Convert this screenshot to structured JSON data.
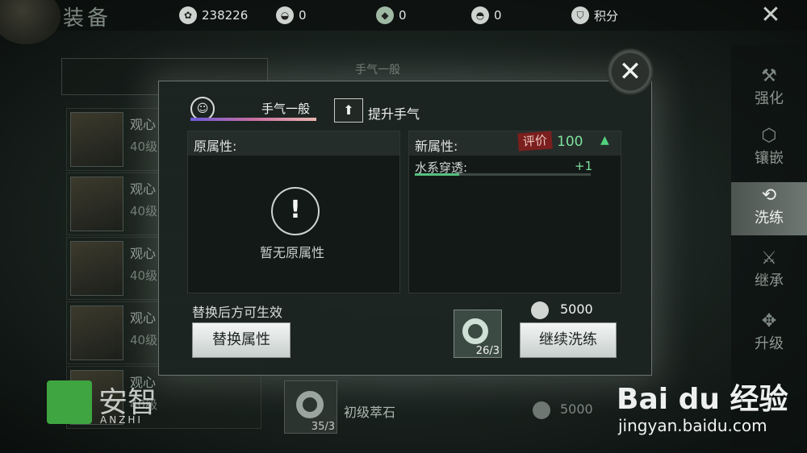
{
  "header": {
    "title": "装备",
    "currencies": [
      {
        "icon": "coin-icon",
        "value": "238226"
      },
      {
        "icon": "bowl-icon",
        "value": "0"
      },
      {
        "icon": "jade-icon",
        "value": "0"
      },
      {
        "icon": "pouch-icon",
        "value": "0"
      },
      {
        "icon": "shield-points-icon",
        "value": "积分"
      }
    ],
    "close_symbol": "✕"
  },
  "left_list": {
    "items": [
      {
        "name": "观心",
        "level": "40级"
      },
      {
        "name": "观心",
        "level": "40级"
      },
      {
        "name": "观心",
        "level": "40级"
      },
      {
        "name": "观心",
        "level": "40级"
      },
      {
        "name": "观心",
        "level": "40级"
      }
    ]
  },
  "right_nav": [
    {
      "label": "强化",
      "icon": "hammer-icon",
      "active": false
    },
    {
      "label": "镶嵌",
      "icon": "gem-icon",
      "active": false
    },
    {
      "label": "洗练",
      "icon": "refine-icon",
      "active": true
    },
    {
      "label": "继承",
      "icon": "inherit-icon",
      "active": false
    },
    {
      "label": "升级",
      "icon": "upgrade-icon",
      "active": false
    }
  ],
  "background_tab": {
    "label": "手气一般"
  },
  "dialog": {
    "luck_label": "手气一般",
    "improve_luck_label": "提升手气",
    "original": {
      "title": "原属性:",
      "empty_text": "暂无原属性"
    },
    "new": {
      "title": "新属性:",
      "eval_stamp": "评价",
      "eval_value": "100",
      "stat_name": "水系穿透:",
      "stat_value": "+1",
      "stat_fill_fraction": 0.25
    },
    "hint": "替换后方可生效",
    "replace_button": "替换属性",
    "stone_count": "26/3",
    "cost_value": "5000",
    "continue_button": "继续洗练"
  },
  "bottom": {
    "stone_count": "35/3",
    "stone_name": "初级萃石",
    "cost_value": "5000"
  },
  "watermarks": {
    "anzhi": "安智",
    "anzhi_sub": "ANZHI",
    "baidu": "Bai du 经验",
    "baidu_url": "jingyan.baidu.com"
  },
  "colors": {
    "accent_green": "#7ce09a",
    "stamp_red": "#7a1f1e",
    "active_tab": "#6e7772"
  }
}
